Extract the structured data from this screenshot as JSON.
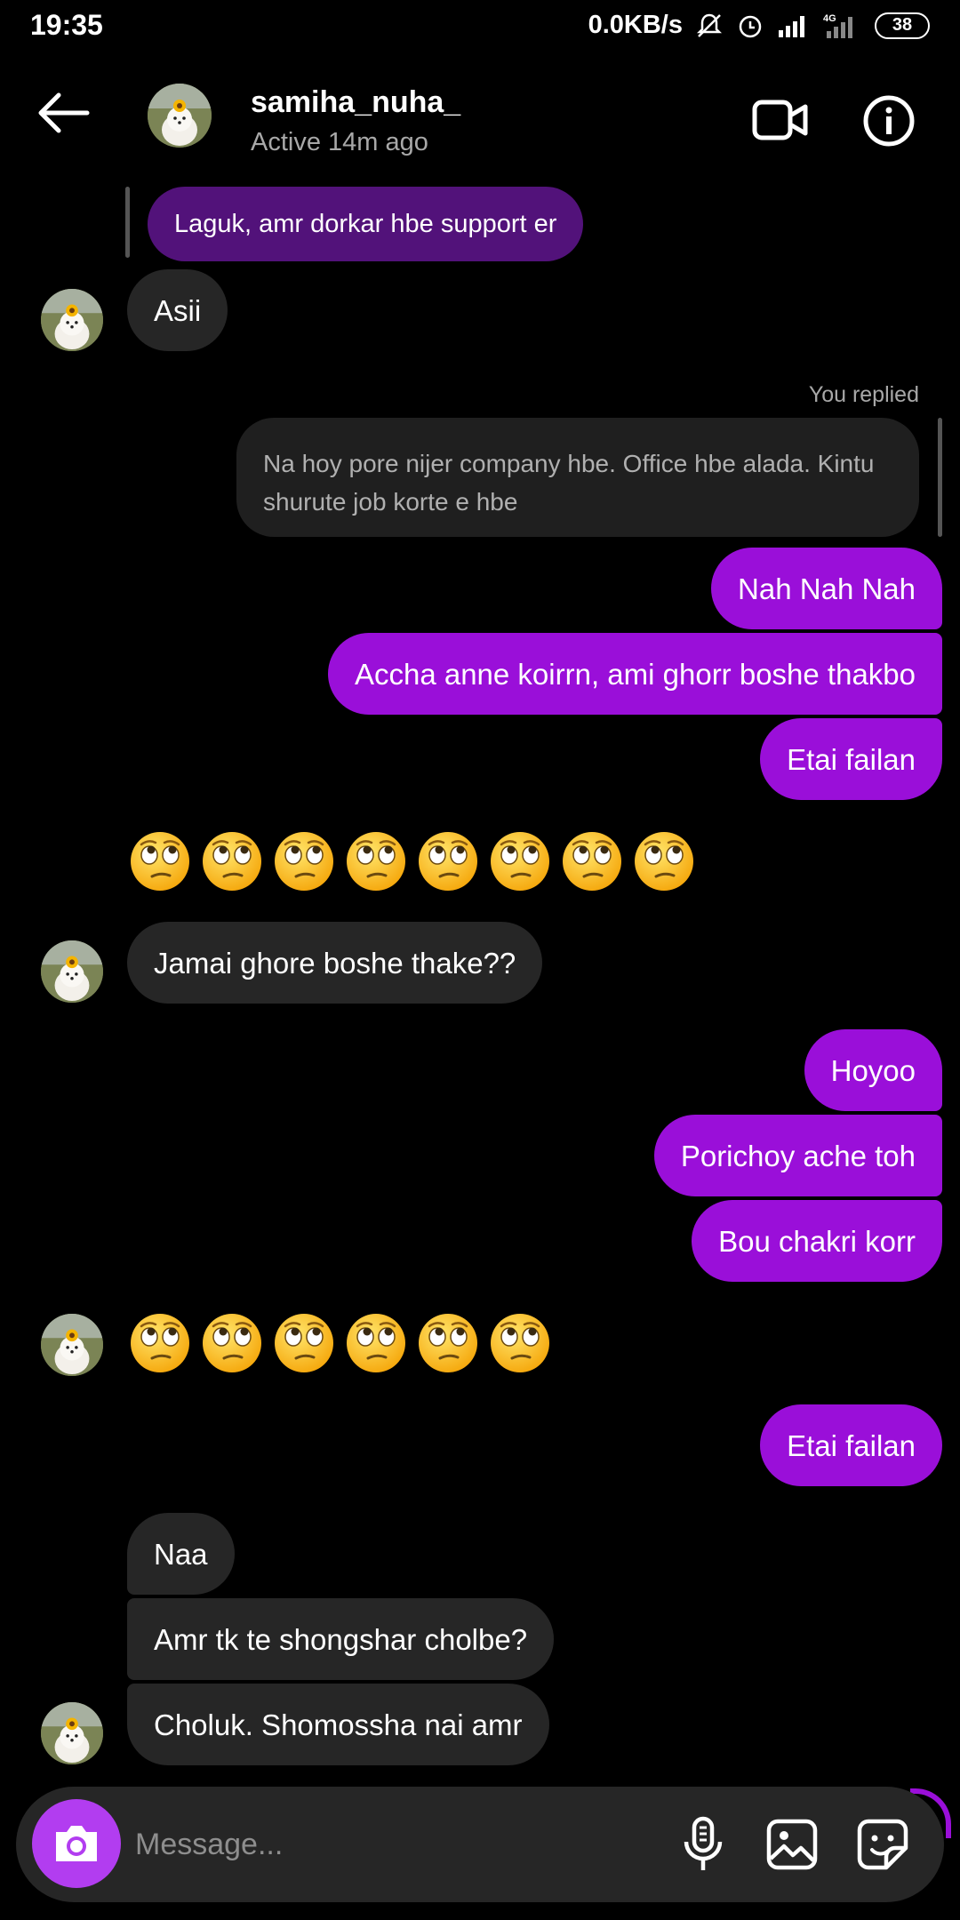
{
  "status_bar": {
    "time": "19:35",
    "net_speed": "0.0KB/s",
    "network_type": "4G",
    "battery": "38"
  },
  "header": {
    "username": "samiha_nuha_",
    "active_status": "Active 14m ago"
  },
  "quoted_message": "Laguk, amr dorkar hbe support er",
  "reply_label": "You replied",
  "replied_text": "Na hoy pore nijer company hbe. Office hbe alada. Kintu shurute job korte e hbe",
  "messages": [
    {
      "from": "them",
      "text": "Asii"
    },
    {
      "from": "me",
      "text": "Nah Nah Nah"
    },
    {
      "from": "me",
      "text": "Accha anne koirrn, ami ghorr boshe thakbo"
    },
    {
      "from": "me",
      "text": "Etai failan"
    },
    {
      "from": "them",
      "text": "🙄🙄🙄🙄🙄🙄🙄🙄"
    },
    {
      "from": "them",
      "text": "Jamai ghore boshe thake??"
    },
    {
      "from": "me",
      "text": "Hoyoo"
    },
    {
      "from": "me",
      "text": "Porichoy ache toh"
    },
    {
      "from": "me",
      "text": "Bou chakri korr"
    },
    {
      "from": "them",
      "text": "🙄🙄🙄🙄🙄🙄"
    },
    {
      "from": "me",
      "text": "Etai failan"
    },
    {
      "from": "them",
      "text": "Naa"
    },
    {
      "from": "them",
      "text": "Amr tk te shongshar cholbe?"
    },
    {
      "from": "them",
      "text": "Choluk. Shomossha nai amr"
    }
  ],
  "emoji_rows": [
    8,
    6
  ],
  "composer": {
    "placeholder": "Message..."
  },
  "colors": {
    "sent_bubble": "#9a0fd9",
    "received_bubble": "#262626",
    "camera_button": "#b23df0"
  },
  "icons": [
    "back-arrow-icon",
    "video-call-icon",
    "info-icon",
    "camera-icon",
    "microphone-icon",
    "gallery-icon",
    "sticker-icon"
  ]
}
